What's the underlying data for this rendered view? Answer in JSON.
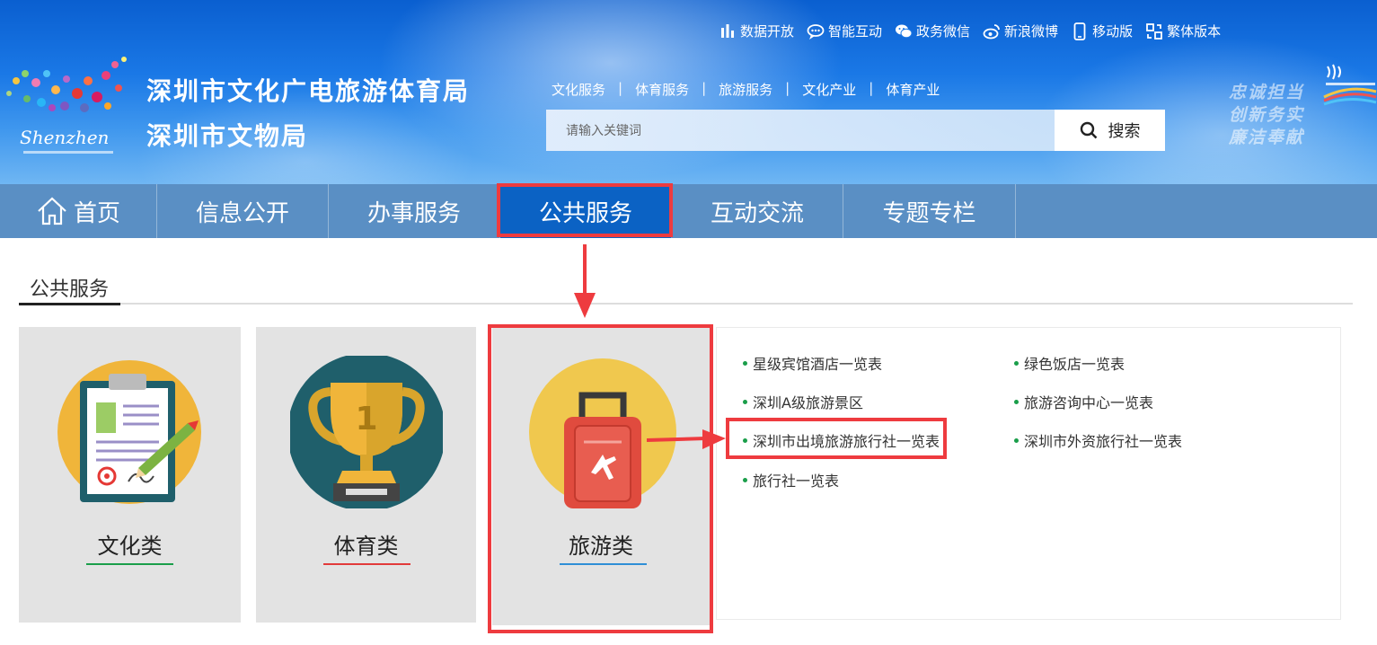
{
  "header": {
    "site_title_line1": "深圳市文化广电旅游体育局",
    "site_title_line2": "深圳市文物局",
    "logo_text": "Shenzhen",
    "top_links": [
      {
        "label": "数据开放",
        "icon": "bar-chart-icon"
      },
      {
        "label": "智能互动",
        "icon": "chat-bubble-icon"
      },
      {
        "label": "政务微信",
        "icon": "wechat-icon"
      },
      {
        "label": "新浪微博",
        "icon": "weibo-icon"
      },
      {
        "label": "移动版",
        "icon": "mobile-phone-icon"
      },
      {
        "label": "繁体版本",
        "icon": "traditional-chinese-icon"
      }
    ],
    "quick_nav": [
      "文化服务",
      "体育服务",
      "旅游服务",
      "文化产业",
      "体育产业"
    ],
    "separator": "|",
    "search": {
      "placeholder": "请输入关键词",
      "button_label": "搜索"
    },
    "calligraphy": [
      "忠诚担当",
      "创新务实",
      "廉洁奉献"
    ]
  },
  "nav": {
    "items": [
      "首页",
      "信息公开",
      "办事服务",
      "公共服务",
      "互动交流",
      "专题专栏"
    ],
    "active_index": 3
  },
  "section": {
    "title": "公共服务",
    "cards": [
      {
        "label": "文化类",
        "underline_color": "#1a9e4a"
      },
      {
        "label": "体育类",
        "underline_color": "#e23a3a"
      },
      {
        "label": "旅游类",
        "underline_color": "#2f8fd6"
      }
    ],
    "links_left": [
      "星级宾馆酒店一览表",
      "深圳A级旅游景区",
      "深圳市出境旅游旅行社一览表",
      "旅行社一览表"
    ],
    "links_right": [
      "绿色饭店一览表",
      "旅游咨询中心一览表",
      "深圳市外资旅行社一览表"
    ]
  },
  "colors": {
    "highlight": "#ee3b3f",
    "nav_bg": "#5a8fc4",
    "nav_active": "#0b62c4",
    "bullet": "#1a9e4a"
  }
}
